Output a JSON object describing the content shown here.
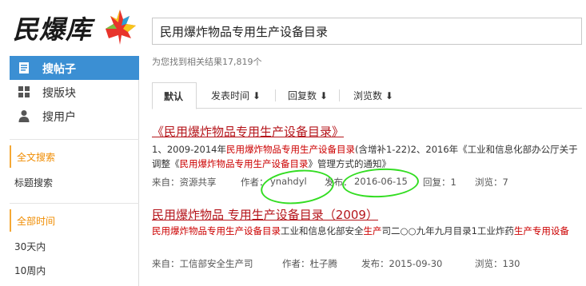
{
  "logo": {
    "text": "民爆库"
  },
  "search": {
    "value": "民用爆炸物品专用生产设备目录"
  },
  "sidebar": {
    "nav": [
      {
        "label": "搜帖子",
        "icon": "document-icon",
        "active": true
      },
      {
        "label": "搜版块",
        "icon": "grid-icon",
        "active": false
      },
      {
        "label": "搜用户",
        "icon": "user-icon",
        "active": false
      }
    ],
    "fulltext_header": "全文搜索",
    "title_search": "标题搜索",
    "time_header": "全部时间",
    "time_options": [
      "30天内",
      "10周内"
    ]
  },
  "result_count": "为您找到相关结果17,819个",
  "tabs": [
    {
      "label": "默认",
      "active": true
    },
    {
      "label": "发表时间 ⬇",
      "active": false
    },
    {
      "label": "回复数 ⬇",
      "active": false
    },
    {
      "label": "浏览数 ⬇",
      "active": false
    }
  ],
  "results": [
    {
      "title": "《民用爆炸物品专用生产设备目录》",
      "snippet_parts": [
        "1、2009-2014年",
        "民用爆炸物品专用生产设备目录",
        "(含增补1-22)2、2016年《工业和信息化部办公厅关于调整《",
        "民用爆炸物品专用生产设备目录",
        "》管理方式的通知》"
      ],
      "meta": {
        "source_label": "来自：资源共享",
        "author_label": "作者：",
        "author": "ynahdyl",
        "date_label": "发布：",
        "date": "2016-06-15",
        "replies": "回复：1",
        "views": "浏览：7"
      }
    },
    {
      "title": "民用爆炸物品 专用生产设备目录（2009）",
      "snippet_parts": [
        "民用爆炸物品专用生产设备目录",
        "工业和信息化部安全",
        "生产",
        "司二○○九年九月目录1工业炸药",
        "生产",
        "专用设备"
      ],
      "meta": {
        "source_label": "来自：工信部安全生产司",
        "author_label": "作者：杜子腾",
        "date_label": "发布：2015-09-30",
        "views": "浏览：130"
      }
    }
  ],
  "colors": {
    "accent": "#3b8fd3",
    "title_red": "#b5151b",
    "highlight": "#cc0000",
    "orange": "#f08c00",
    "annotation": "#33dd22"
  }
}
